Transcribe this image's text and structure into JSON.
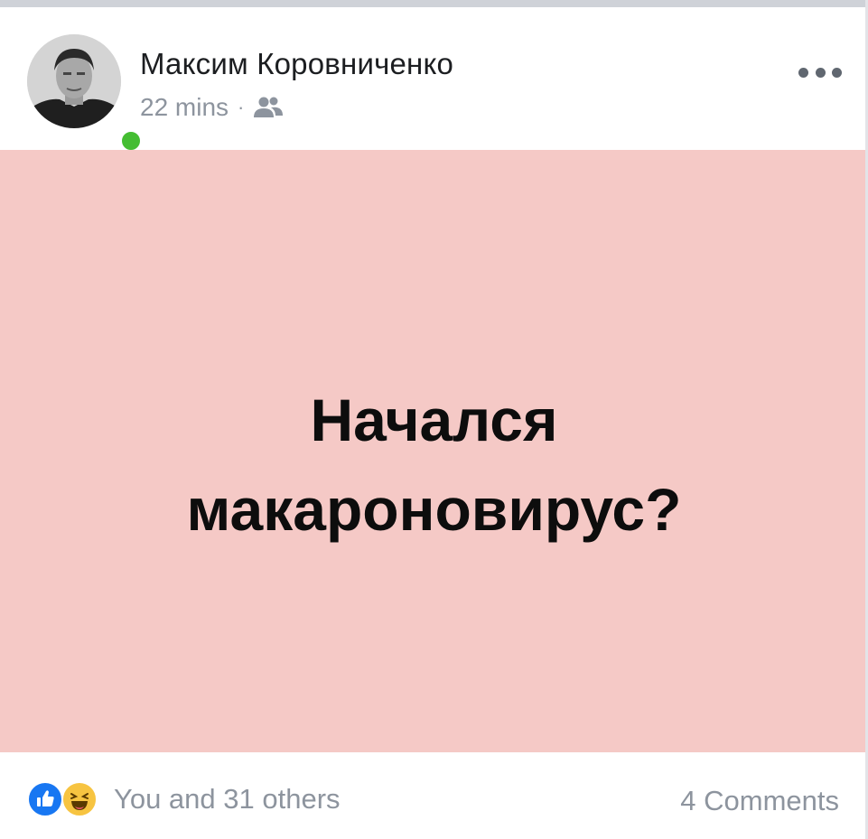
{
  "post": {
    "author_name": "Максим Коровниченко",
    "timestamp": "22 mins",
    "separator": "·",
    "audience_icon": "friends-icon",
    "more_icon": "more-options-icon",
    "background_color": "#f5c9c6",
    "text_line1": "Начался",
    "text_line2": "макароновирус?"
  },
  "footer": {
    "reactions": [
      "like-icon",
      "haha-icon"
    ],
    "reactions_label": "You and 31 others",
    "comments_label": "4 Comments"
  },
  "colors": {
    "online": "#44bd32",
    "like": "#1877f2",
    "haha": "#f7c441",
    "meta_text": "#8d949e"
  }
}
